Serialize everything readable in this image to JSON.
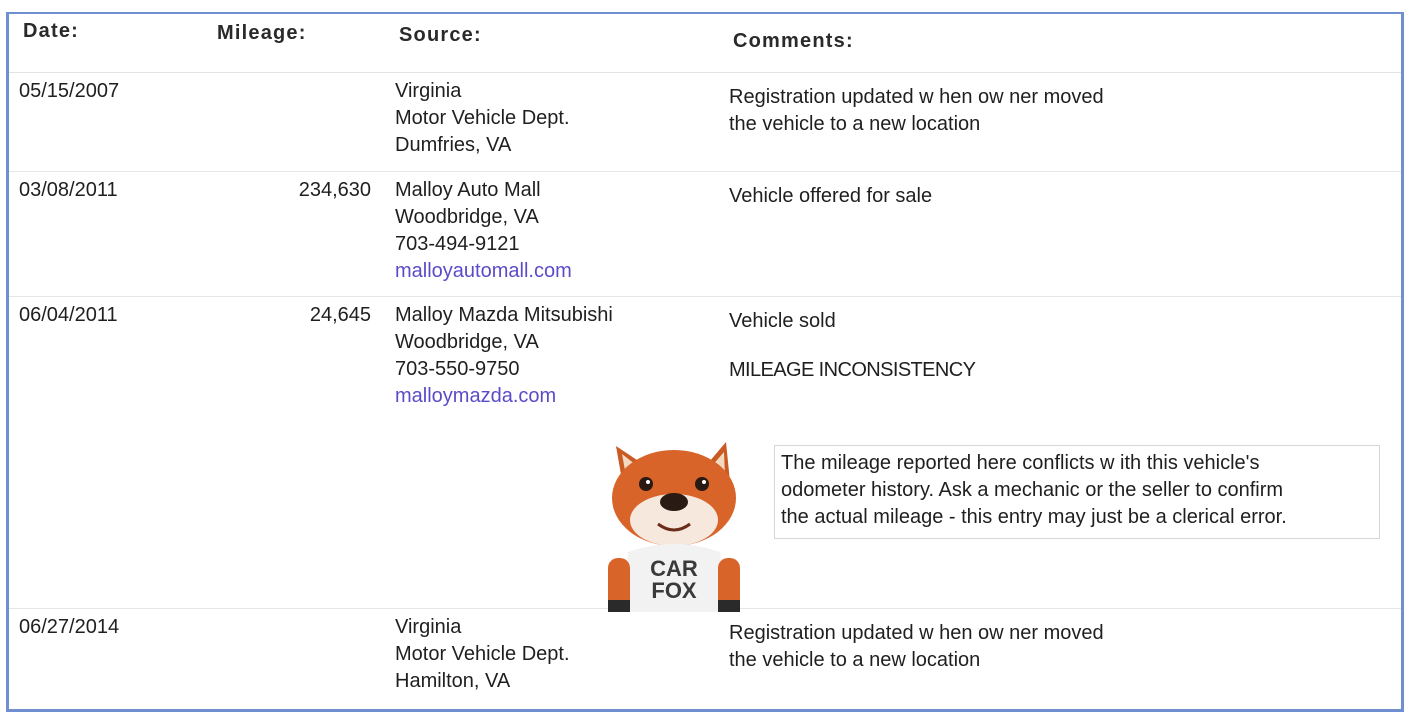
{
  "headers": {
    "date": "Date:",
    "mileage": "Mileage:",
    "source": "Source:",
    "comments": "Comments:"
  },
  "rows": [
    {
      "date": "05/15/2007",
      "mileage": "",
      "source": [
        "Virginia",
        "Motor Vehicle Dept.",
        "Dumfries, VA"
      ],
      "source_link": "",
      "comments": [
        "Registration updated w hen ow ner moved",
        "the vehicle to a new  location"
      ]
    },
    {
      "date": "03/08/2011",
      "mileage": "234,630",
      "source": [
        "Malloy Auto Mall",
        "Woodbridge, VA",
        "703-494-9121"
      ],
      "source_link": "malloyautomall.com",
      "comments": [
        "Vehicle offered for sale"
      ]
    },
    {
      "date": "06/04/2011",
      "mileage": "24,645",
      "source": [
        "Malloy Mazda Mitsubishi",
        "Woodbridge, VA",
        "703-550-9750"
      ],
      "source_link": "malloymazda.com",
      "comments": [
        "Vehicle sold"
      ],
      "flag": "MILEAGE INCONSISTENCY",
      "callout": [
        "The mileage reported here conflicts w ith this vehicle's",
        "odometer history. Ask a mechanic or the seller to confirm",
        "the actual mileage - this entry may just be a clerical error."
      ],
      "mascot_text": [
        "CAR",
        "FOX"
      ]
    },
    {
      "date": "06/27/2014",
      "mileage": "",
      "source": [
        "Virginia",
        "Motor Vehicle Dept.",
        "Hamilton, VA"
      ],
      "source_link": "",
      "comments": [
        "Registration updated w hen ow ner moved",
        "the vehicle to a new  location"
      ]
    }
  ],
  "colors": {
    "border": "#6f8fd0",
    "link": "#5a4cc8",
    "fox_orange": "#d8642a"
  }
}
